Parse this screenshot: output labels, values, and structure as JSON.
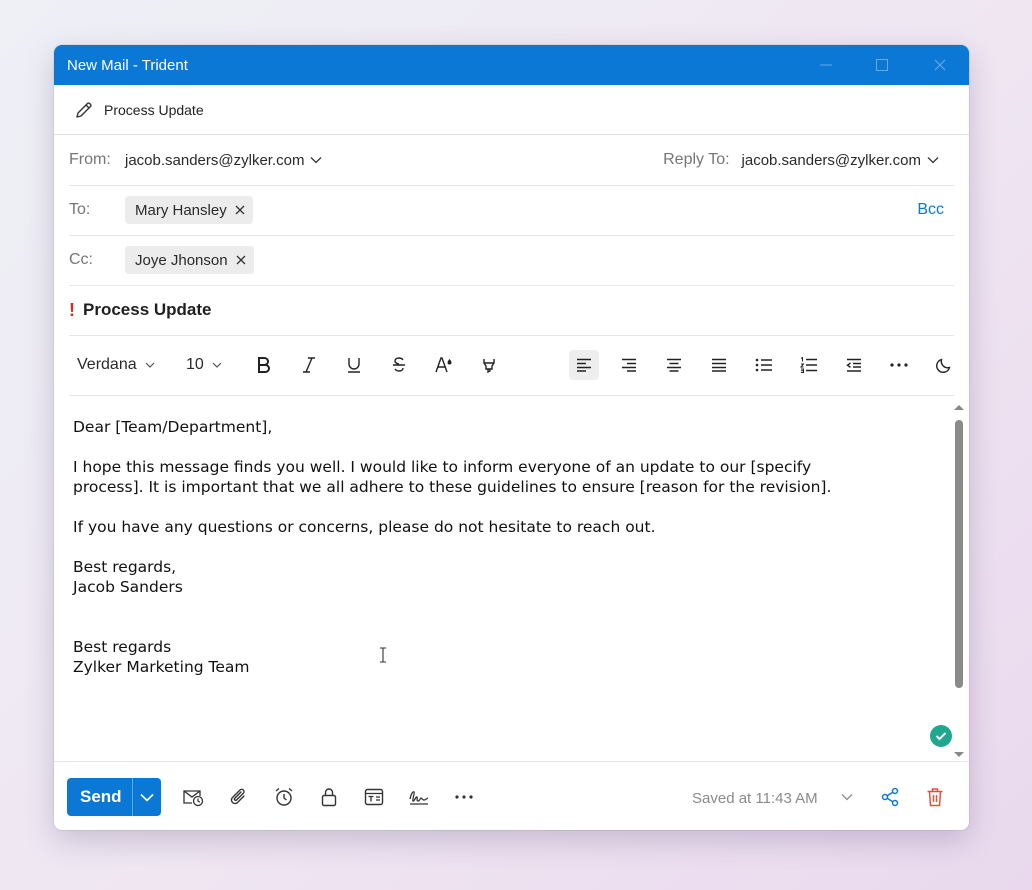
{
  "window": {
    "title": "New Mail - Trident"
  },
  "subject_bar": {
    "label": "Process Update"
  },
  "from": {
    "label": "From:",
    "address": "jacob.sanders@zylker.com"
  },
  "reply_to": {
    "label": "Reply To:",
    "address": "jacob.sanders@zylker.com"
  },
  "to": {
    "label": "To:",
    "recipients": [
      "Mary Hansley"
    ],
    "bcc_label": "Bcc"
  },
  "cc": {
    "label": "Cc:",
    "recipients": [
      "Joye Jhonson"
    ]
  },
  "subject": {
    "text": "Process Update",
    "priority_mark": "!"
  },
  "toolbar": {
    "font": "Verdana",
    "size": "10"
  },
  "body": {
    "paragraphs": [
      "Dear [Team/Department],",
      "I hope this message finds you well. I would like to inform everyone of an update to our [specify\nprocess]. It is important that we all adhere to these guidelines to ensure [reason for the revision].",
      "If you have any questions or concerns, please do not hesitate to reach out.",
      "Best regards,\nJacob Sanders",
      "Best regards\nZylker Marketing Team"
    ]
  },
  "footer": {
    "send_label": "Send",
    "saved_text": "Saved at 11:43 AM"
  },
  "colors": {
    "accent": "#0a78d4",
    "delete": "#e0503f",
    "priority": "#d62a1f",
    "saved_check": "#1fa88f"
  }
}
